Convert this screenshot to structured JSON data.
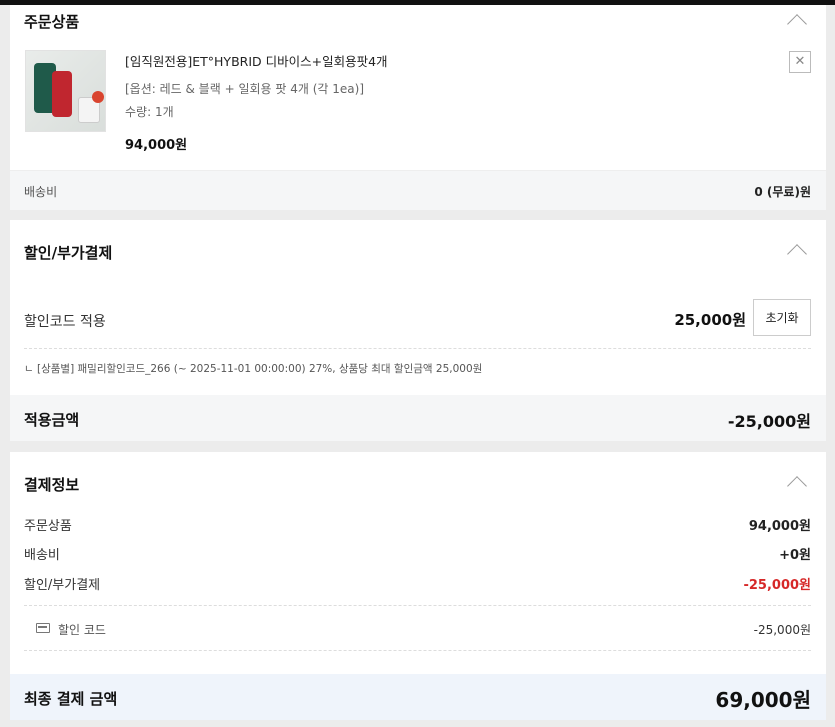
{
  "order": {
    "title": "주문상품",
    "product": {
      "image_alt": "ET HYBRID device product image",
      "name": "[임직원전용]ET°HYBRID 디바이스+일회용팟4개",
      "option": "[옵션: 레드 & 블랙 + 일회용 팟 4개 (각 1ea)]",
      "quantity": "수량: 1개",
      "price": "94,000원",
      "remove_symbol": "✕"
    },
    "shipping": {
      "label": "배송비",
      "value": "0 (무료)원"
    }
  },
  "discount": {
    "title": "할인/부가결제",
    "code_label": "할인코드 적용",
    "code_amount": "25,000원",
    "reset_label": "초기화",
    "code_detail": "ㄴ [상품별] 패밀리할인코드_266 (~ 2025-11-01 00:00:00)  27%, 상품당 최대 할인금액 25,000원",
    "applied_label": "적용금액",
    "applied_value": "-25,000원"
  },
  "payment": {
    "title": "결제정보",
    "lines": [
      {
        "label": "주문상품",
        "value": "94,000원"
      },
      {
        "label": "배송비",
        "value": "+0원"
      },
      {
        "label": "할인/부가결제",
        "value": "-25,000원"
      }
    ],
    "code_line": {
      "icon": "card-icon",
      "label": "할인 코드",
      "value": "-25,000원"
    },
    "final_label": "최종 결제 금액",
    "final_value": "69,000원"
  },
  "colors": {
    "negative": "#d62828",
    "final_bg": "#eff4fb",
    "page_bg": "#ececec"
  }
}
